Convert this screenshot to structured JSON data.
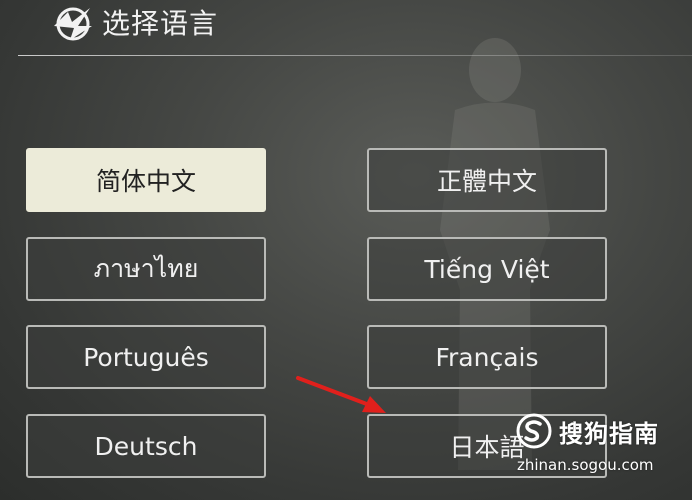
{
  "header": {
    "title": "选择语言",
    "logo_icon": "game-logo-icon"
  },
  "languages": {
    "selected": "简体中文",
    "items": [
      {
        "label": "简体中文",
        "selected": true
      },
      {
        "label": "正體中文",
        "selected": false
      },
      {
        "label": "ภาษาไทย",
        "selected": false
      },
      {
        "label": "Tiếng Việt",
        "selected": false
      },
      {
        "label": "Português",
        "selected": false
      },
      {
        "label": "Français",
        "selected": false
      },
      {
        "label": "Deutsch",
        "selected": false
      },
      {
        "label": "日本語",
        "selected": false
      }
    ]
  },
  "annotation": {
    "arrow_icon": "red-arrow-icon",
    "arrow_color": "#e0201c"
  },
  "watermark": {
    "logo_icon": "sogou-logo-icon",
    "text": "搜狗指南",
    "url": "zhinan.sogou.com"
  },
  "colors": {
    "selected_bg": "#ecebd9",
    "button_border": "#b9bab7",
    "text_light": "#f0f0f0"
  }
}
